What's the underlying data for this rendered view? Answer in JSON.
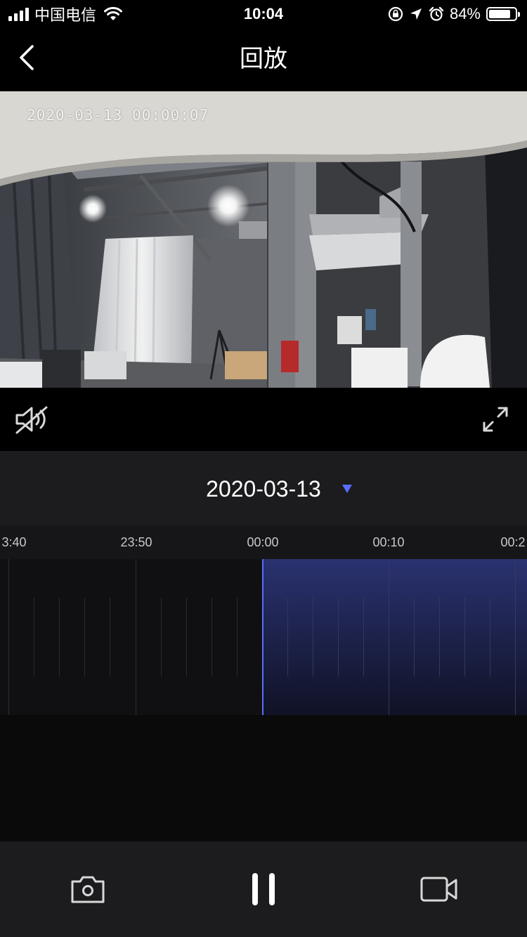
{
  "status_bar": {
    "carrier": "中国电信",
    "time": "10:04",
    "battery_percent": "84%",
    "battery_level": 0.84
  },
  "nav": {
    "title": "回放"
  },
  "video": {
    "osd_timestamp": "2020-03-13 00:00:07",
    "muted": true
  },
  "date_selector": {
    "date": "2020-03-13"
  },
  "timeline": {
    "labels": [
      "3:40",
      "23:50",
      "00:00",
      "00:10",
      "00:2"
    ],
    "current_time": "00:00",
    "recorded_from": "00:00",
    "accent_color": "#5a6cff"
  },
  "toolbar": {
    "items": [
      "camera-icon",
      "pause-icon",
      "video-record-icon"
    ]
  }
}
